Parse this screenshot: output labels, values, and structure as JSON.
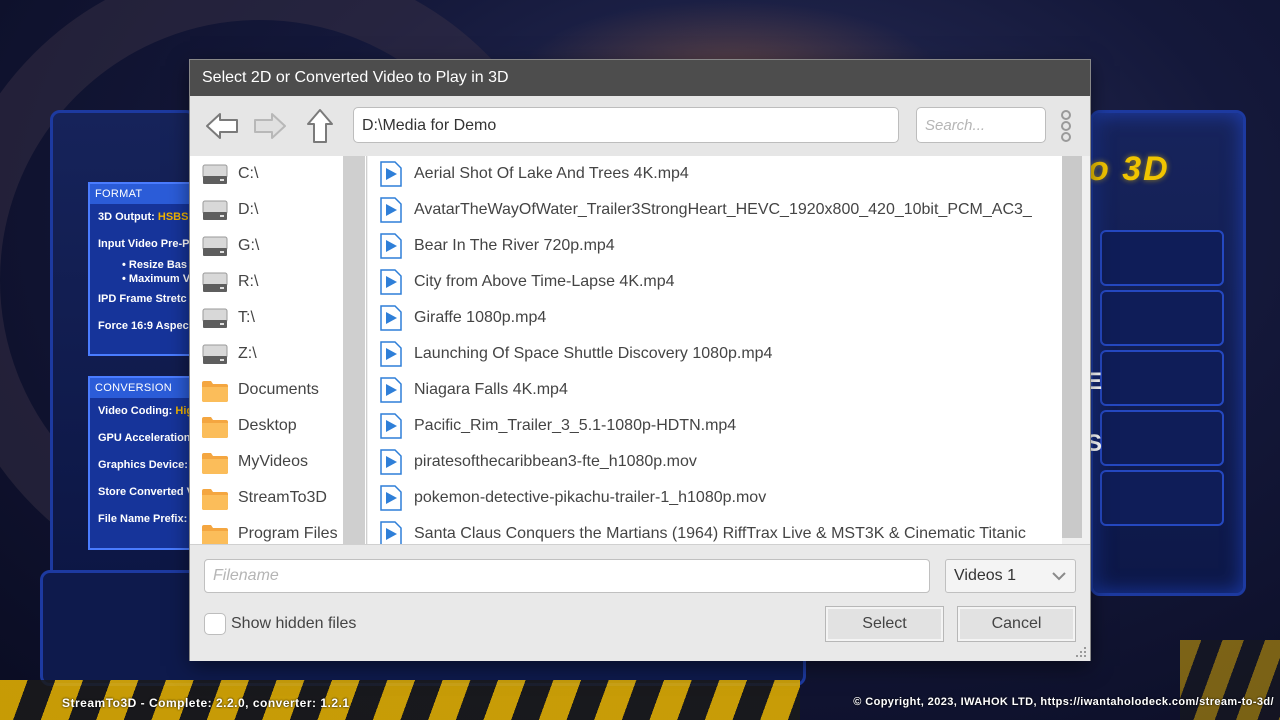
{
  "background_app": {
    "format_panel": {
      "header": "FORMAT",
      "rows": [
        {
          "label": "3D Output: ",
          "value": "HSBS"
        },
        {
          "label": "Input Video Pre-P",
          "value": ""
        }
      ],
      "subrows": [
        "• Resize Bas",
        "• Maximum V"
      ],
      "rows2": [
        {
          "label": "IPD Frame Stretc",
          "value": ""
        },
        {
          "label": "Force 16:9 Aspec",
          "value": ""
        }
      ]
    },
    "conversion_panel": {
      "header": "CONVERSION",
      "rows": [
        {
          "label": "Video Coding: ",
          "value": "Hig"
        },
        {
          "label": "GPU Acceleration",
          "value": ""
        },
        {
          "label": "Graphics Device:",
          "value": ""
        },
        {
          "label": "Store Converted V",
          "value": ""
        },
        {
          "label": "File Name Prefix:",
          "value": ""
        }
      ]
    },
    "logo_text": "o 3D",
    "right_chars": [
      "E",
      "S"
    ],
    "footer_left": "StreamTo3D - Complete: 2.2.0, converter: 1.2.1",
    "footer_right": "© Copyright, 2023, IWAHOK LTD, https://iwantaholodeck.com/stream-to-3d/"
  },
  "dialog": {
    "title": "Select 2D or Converted Video to Play in 3D",
    "path": "D:\\Media for Demo",
    "search_placeholder": "Search...",
    "sidebar": [
      {
        "label": "C:\\",
        "icon": "drive-icon"
      },
      {
        "label": "D:\\",
        "icon": "drive-icon"
      },
      {
        "label": "G:\\",
        "icon": "drive-icon"
      },
      {
        "label": "R:\\",
        "icon": "drive-icon"
      },
      {
        "label": "T:\\",
        "icon": "drive-icon"
      },
      {
        "label": "Z:\\",
        "icon": "drive-icon"
      },
      {
        "label": "Documents",
        "icon": "folder-icon"
      },
      {
        "label": "Desktop",
        "icon": "folder-icon"
      },
      {
        "label": "MyVideos",
        "icon": "folder-icon"
      },
      {
        "label": "StreamTo3D",
        "icon": "folder-icon"
      },
      {
        "label": "Program Files",
        "icon": "folder-icon"
      }
    ],
    "files": [
      "Aerial Shot Of Lake And Trees 4K.mp4",
      "AvatarTheWayOfWater_Trailer3StrongHeart_HEVC_1920x800_420_10bit_PCM_AC3_",
      "Bear In The River 720p.mp4",
      "City from Above Time-Lapse 4K.mp4",
      "Giraffe 1080p.mp4",
      "Launching Of Space Shuttle Discovery 1080p.mp4",
      "Niagara Falls 4K.mp4",
      "Pacific_Rim_Trailer_3_5.1-1080p-HDTN.mp4",
      "piratesofthecaribbean3-fte_h1080p.mov",
      "pokemon-detective-pikachu-trailer-1_h1080p.mov",
      "Santa Claus Conquers the Martians (1964) RiffTrax Live & MST3K & Cinematic Titanic"
    ],
    "filename_placeholder": "Filename",
    "filter_value": "Videos 1",
    "show_hidden_label": "Show hidden files",
    "select_label": "Select",
    "cancel_label": "Cancel"
  }
}
